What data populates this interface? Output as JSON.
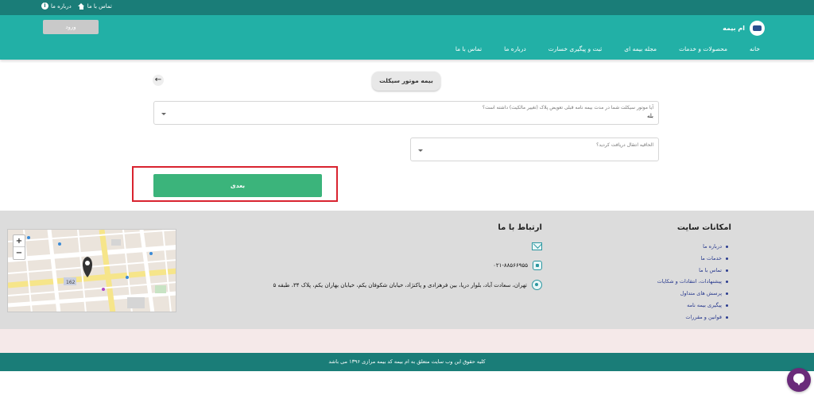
{
  "topbar": {
    "links": [
      {
        "label": "درباره ما",
        "icon": "info-icon"
      },
      {
        "label": "تماس با ما",
        "icon": "home-icon"
      }
    ]
  },
  "header": {
    "brand": "ام بیمه",
    "login_label": "ورود",
    "nav": [
      "خانه",
      "محصولات و خدمات",
      "مجله بیمه ای",
      "ثبت و پیگیری خسارت",
      "درباره ما",
      "تماس با ما"
    ]
  },
  "form": {
    "title": "بیمه موتور سیکلت",
    "q1_label": "آیا موتور سیکلت شما در مدت بیمه نامه قبلی تعویض پلاک (تغییر مالکیت) داشته است؟",
    "q1_value": "بله",
    "q2_label": "الحاقیه انتقال دریافت کردید؟",
    "next_label": "بعدی"
  },
  "footer": {
    "features_title": "امکانات سایت",
    "features": [
      "درباره ما",
      "خدمات ما",
      "تماس با ما",
      "پیشنهادات، انتقادات و شکایات",
      "پرسش های متداول",
      "پیگیری بیمه نامه",
      "قوانین و مقررات"
    ],
    "contact_title": "ارتباط با ما",
    "phone": "۰۲۱-۸۸۵۶۶۹۵۵",
    "address": "تهران، سعادت آباد، بلوار دریا، بین فرهزادی و پاکنژاد، خیابان شکوفان یکم، خیابان بهاران یکم، پلاک ۳۴، طبقه ۵",
    "map_marker_label": "162"
  },
  "copyright": "کلیه حقوق این وب سایت متعلق به ام بیمه کد بیمه مرازی ۱۳۹۶ می باشد",
  "colors": {
    "topbar": "#1a7d78",
    "header": "#22b0a6",
    "primary_button": "#3bb47b",
    "highlight": "#d9232f"
  }
}
